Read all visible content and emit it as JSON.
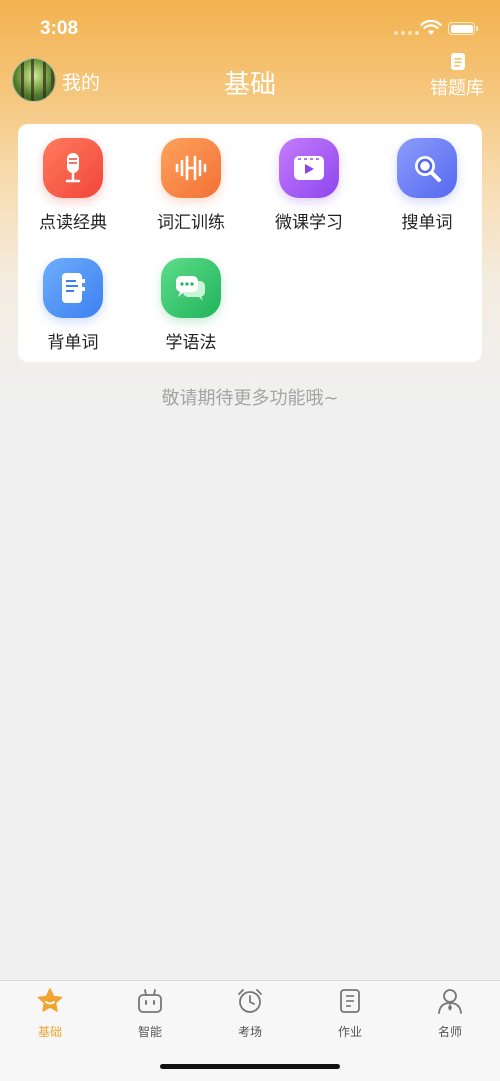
{
  "status_bar": {
    "time": "3:08"
  },
  "nav": {
    "mine_label": "我的",
    "title": "基础",
    "wrongbook_label": "错题库"
  },
  "features": [
    {
      "label": "点读经典",
      "icon": "microphone-icon",
      "color": "#f4604a"
    },
    {
      "label": "词汇训练",
      "icon": "waveform-icon",
      "color": "#f7894a"
    },
    {
      "label": "微课学习",
      "icon": "video-play-icon",
      "color": "#a45ff0"
    },
    {
      "label": "搜单词",
      "icon": "search-icon",
      "color": "#6a7ff6"
    },
    {
      "label": "背单词",
      "icon": "notebook-icon",
      "color": "#4a8ef3"
    },
    {
      "label": "学语法",
      "icon": "chat-bubbles-icon",
      "color": "#34c36a"
    }
  ],
  "promo_text": "敬请期待更多功能哦~",
  "tabs": [
    {
      "label": "基础",
      "icon": "star-icon",
      "active": true
    },
    {
      "label": "智能",
      "icon": "robot-icon",
      "active": false
    },
    {
      "label": "考场",
      "icon": "alarm-clock-icon",
      "active": false
    },
    {
      "label": "作业",
      "icon": "document-icon",
      "active": false
    },
    {
      "label": "名师",
      "icon": "teacher-icon",
      "active": false
    }
  ],
  "colors": {
    "accent": "#f0a431",
    "header_top": "#f2b24f",
    "background": "#f0f0f0"
  }
}
